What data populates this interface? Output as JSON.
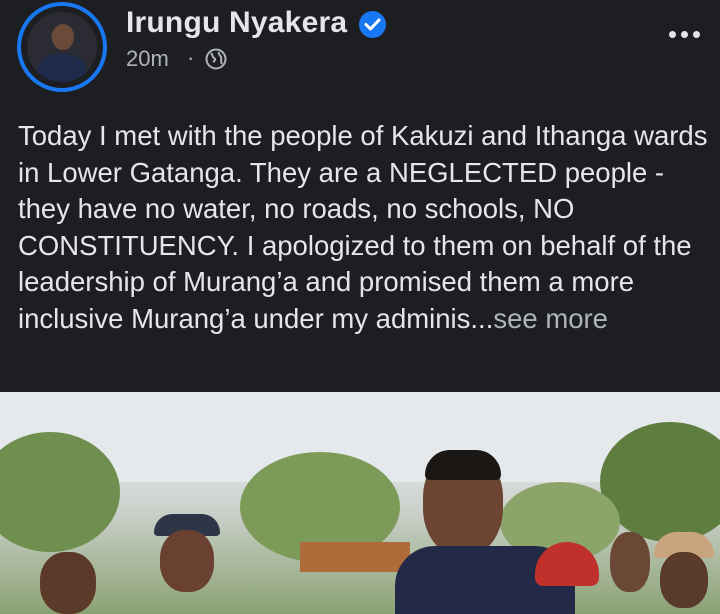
{
  "post": {
    "author": "Irungu Nyakera",
    "verified": true,
    "time": "20m",
    "separator": "·",
    "audience_icon": "globe-icon",
    "text_main": "Today I met with the people of Kakuzi and Ithanga wards in Lower Gatanga. They are a NEGLECTED people - they have no water, no roads, no schools, NO CONSTITUENCY. I apologized to them on behalf of the leadership of Murang’a and promised them a more inclusive Murang’a under my adminis...",
    "see_more": "see more",
    "menu_icon": "more-options-icon"
  },
  "colors": {
    "background": "#1c1e21",
    "text": "#e4e6eb",
    "secondary_text": "#b0b3b8",
    "accent": "#1877f2"
  }
}
